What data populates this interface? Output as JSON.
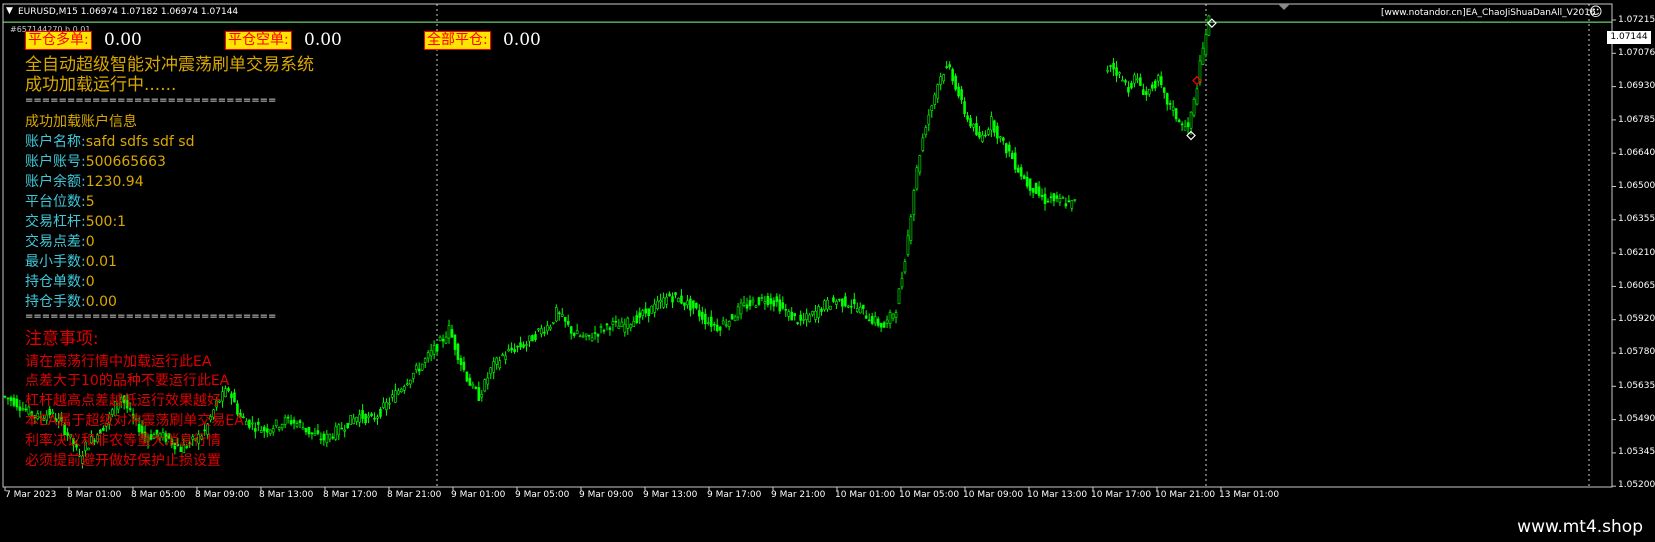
{
  "header": {
    "symbol_info": "EURUSD,M15  1.06974 1.07182 1.06974 1.07144",
    "ea_name": "[www.notandor.cn]EA_ChaoJiShuaDanAll_V2016",
    "ticket_info": "#657144270 b  0.01",
    "smiley": "☺"
  },
  "buttons": [
    {
      "label": "平仓多单:",
      "value": "0.00"
    },
    {
      "label": "平仓空单:",
      "value": "0.00"
    },
    {
      "label": "全部平仓:",
      "value": "0.00"
    }
  ],
  "info": {
    "title": "全自动超级智能对冲震荡刷单交易系统",
    "status": "成功加载运行中......",
    "divider": "==============================",
    "account_header": "成功加载账户信息",
    "rows": [
      {
        "label": "账户名称:",
        "value": "safd   sdfs sdf  sd"
      },
      {
        "label": "账户账号:",
        "value": "500665663"
      },
      {
        "label": "账户余额:",
        "value": "1230.94"
      },
      {
        "label": "平台位数:",
        "value": "5"
      },
      {
        "label": "交易杠杆:",
        "value": "500:1"
      },
      {
        "label": "交易点差:",
        "value": "0"
      },
      {
        "label": "最小手数:",
        "value": "0.01"
      },
      {
        "label": "持仓单数:",
        "value": "0"
      },
      {
        "label": "持仓手数:",
        "value": "0.00"
      }
    ],
    "divider2": "==============================",
    "notes_title": "注意事项:",
    "notes": [
      "请在震荡行情中加载运行此EA",
      "点差大于10的品种不要运行此EA",
      "杠杆越高点差越低运行效果越好",
      "本EA属于超级对冲震荡刷单交易EA",
      "利率决议和非农等重大消息行情",
      "必须提前避开做好保护止损设置"
    ]
  },
  "price_axis": [
    "1.07215",
    "1.07076",
    "1.06930",
    "1.06785",
    "1.06640",
    "1.06500",
    "1.06355",
    "1.06210",
    "1.06065",
    "1.05920",
    "1.05780",
    "1.05635",
    "1.05490",
    "1.05345",
    "1.05200"
  ],
  "current_price": "1.07144",
  "time_axis": [
    "7 Mar 2023",
    "8 Mar 01:00",
    "8 Mar 05:00",
    "8 Mar 09:00",
    "8 Mar 13:00",
    "8 Mar 17:00",
    "8 Mar 21:00",
    "9 Mar 01:00",
    "9 Mar 05:00",
    "9 Mar 09:00",
    "9 Mar 13:00",
    "9 Mar 17:00",
    "9 Mar 21:00",
    "10 Mar 01:00",
    "10 Mar 05:00",
    "10 Mar 09:00",
    "10 Mar 13:00",
    "10 Mar 17:00",
    "10 Mar 21:00",
    "13 Mar 01:00"
  ],
  "watermark": "www.mt4.shop",
  "colors": {
    "candle": "#00ff00",
    "bid_line": "#80ff80",
    "grid": "#ffffff",
    "button_bg": "#ffe600",
    "button_text": "#ff0000"
  },
  "chart_data": {
    "type": "candlestick",
    "symbol": "EURUSD",
    "timeframe": "M15",
    "ylim": [
      1.052,
      1.0722
    ],
    "price_path": [
      [
        0,
        1.0558
      ],
      [
        4,
        1.0556
      ],
      [
        8,
        1.0552
      ],
      [
        12,
        1.0549
      ],
      [
        16,
        1.0551
      ],
      [
        20,
        1.0546
      ],
      [
        24,
        1.0538
      ],
      [
        26,
        1.0532
      ],
      [
        28,
        1.0537
      ],
      [
        31,
        1.0541
      ],
      [
        35,
        1.0547
      ],
      [
        38,
        1.0554
      ],
      [
        40,
        1.0558
      ],
      [
        42,
        1.0553
      ],
      [
        44,
        1.0548
      ],
      [
        46,
        1.0545
      ],
      [
        48,
        1.0541
      ],
      [
        52,
        1.0542
      ],
      [
        56,
        1.054
      ],
      [
        60,
        1.0536
      ],
      [
        64,
        1.0539
      ],
      [
        68,
        1.0543
      ],
      [
        70,
        1.0549
      ],
      [
        72,
        1.0555
      ],
      [
        74,
        1.0558
      ],
      [
        76,
        1.0561
      ],
      [
        78,
        1.0555
      ],
      [
        80,
        1.0549
      ],
      [
        84,
        1.0546
      ],
      [
        88,
        1.0544
      ],
      [
        92,
        1.0546
      ],
      [
        96,
        1.0548
      ],
      [
        100,
        1.0546
      ],
      [
        104,
        1.0542
      ],
      [
        108,
        1.054
      ],
      [
        112,
        1.0543
      ],
      [
        116,
        1.0547
      ],
      [
        120,
        1.055
      ],
      [
        124,
        1.0548
      ],
      [
        128,
        1.0553
      ],
      [
        132,
        1.0559
      ],
      [
        136,
        1.0565
      ],
      [
        140,
        1.057
      ],
      [
        144,
        1.0576
      ],
      [
        148,
        1.0582
      ],
      [
        150,
        1.0586
      ],
      [
        152,
        1.0579
      ],
      [
        154,
        1.0572
      ],
      [
        156,
        1.0566
      ],
      [
        158,
        1.0561
      ],
      [
        160,
        1.0558
      ],
      [
        162,
        1.0563
      ],
      [
        164,
        1.0569
      ],
      [
        168,
        1.0575
      ],
      [
        172,
        1.0578
      ],
      [
        176,
        1.058
      ],
      [
        180,
        1.0585
      ],
      [
        184,
        1.0588
      ],
      [
        186,
        1.0593
      ],
      [
        188,
        1.059
      ],
      [
        192,
        1.0584
      ],
      [
        196,
        1.0582
      ],
      [
        200,
        1.0585
      ],
      [
        204,
        1.0588
      ],
      [
        208,
        1.0587
      ],
      [
        212,
        1.059
      ],
      [
        216,
        1.0593
      ],
      [
        220,
        1.0596
      ],
      [
        224,
        1.06
      ],
      [
        228,
        1.0598
      ],
      [
        232,
        1.0595
      ],
      [
        236,
        1.059
      ],
      [
        240,
        1.0587
      ],
      [
        244,
        1.059
      ],
      [
        248,
        1.0595
      ],
      [
        252,
        1.0597
      ],
      [
        256,
        1.0599
      ],
      [
        260,
        1.0597
      ],
      [
        264,
        1.0592
      ],
      [
        268,
        1.0589
      ],
      [
        272,
        1.0592
      ],
      [
        276,
        1.0596
      ],
      [
        280,
        1.0598
      ],
      [
        284,
        1.0597
      ],
      [
        288,
        1.0594
      ],
      [
        292,
        1.059
      ],
      [
        296,
        1.0587
      ],
      [
        300,
        1.0595
      ],
      [
        302,
        1.0608
      ],
      [
        304,
        1.0625
      ],
      [
        306,
        1.0645
      ],
      [
        308,
        1.066
      ],
      [
        310,
        1.0672
      ],
      [
        312,
        1.068
      ],
      [
        314,
        1.0689
      ],
      [
        316,
        1.0694
      ],
      [
        318,
        1.0695
      ],
      [
        320,
        1.0688
      ],
      [
        322,
        1.068
      ],
      [
        324,
        1.0674
      ],
      [
        326,
        1.067
      ],
      [
        328,
        1.0665
      ],
      [
        330,
        1.0669
      ],
      [
        332,
        1.0673
      ],
      [
        334,
        1.0668
      ],
      [
        336,
        1.0663
      ],
      [
        338,
        1.066
      ],
      [
        340,
        1.0655
      ],
      [
        342,
        1.0651
      ],
      [
        344,
        1.0647
      ],
      [
        346,
        1.0645
      ],
      [
        348,
        1.0642
      ],
      [
        350,
        1.064
      ],
      [
        352,
        1.0641
      ],
      [
        354,
        1.0639
      ],
      [
        356,
        1.064
      ],
      [
        358,
        1.0638
      ],
      [
        360,
        1.0639
      ],
      [
        370,
        1.0693
      ],
      [
        372,
        1.0697
      ],
      [
        374,
        1.0694
      ],
      [
        376,
        1.069
      ],
      [
        378,
        1.0687
      ],
      [
        380,
        1.0691
      ],
      [
        382,
        1.0688
      ],
      [
        384,
        1.0684
      ],
      [
        386,
        1.0688
      ],
      [
        388,
        1.069
      ],
      [
        390,
        1.0683
      ],
      [
        392,
        1.0679
      ],
      [
        394,
        1.0675
      ],
      [
        396,
        1.0671
      ],
      [
        398,
        1.067
      ],
      [
        400,
        1.0681
      ],
      [
        402,
        1.0696
      ],
      [
        404,
        1.071
      ],
      [
        405,
        1.0715
      ]
    ],
    "marker_points": [
      {
        "i": 400,
        "price": 1.069,
        "color": "#ff0000"
      },
      {
        "i": 398,
        "price": 1.0667,
        "color": "#ffffff"
      },
      {
        "i": 405,
        "price": 1.0714,
        "color": "#ffffff"
      }
    ]
  }
}
